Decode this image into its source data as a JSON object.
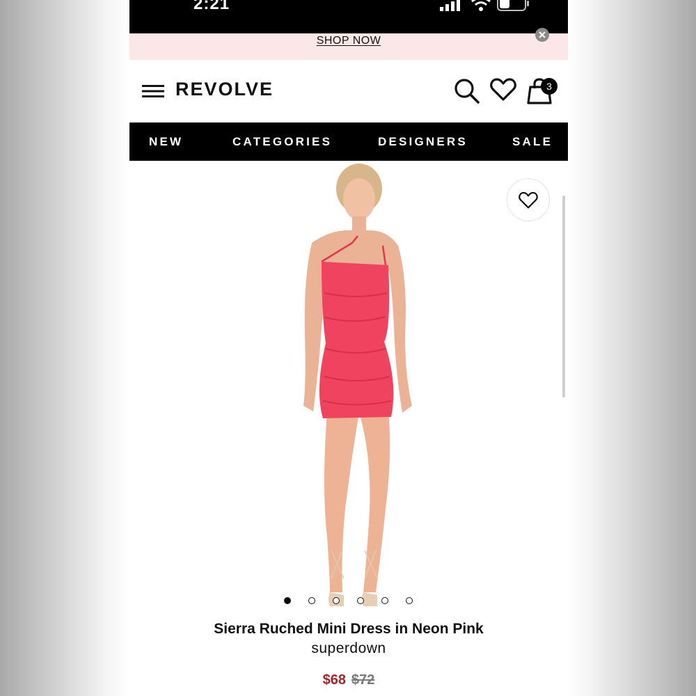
{
  "status_bar": {
    "time": "2:21"
  },
  "promo": {
    "link_label": "SHOP NOW"
  },
  "header": {
    "logo": "REVOLVE",
    "bag_count": "3"
  },
  "nav": {
    "items": [
      {
        "label": "NEW"
      },
      {
        "label": "CATEGORIES"
      },
      {
        "label": "DESIGNERS"
      },
      {
        "label": "SALE"
      }
    ]
  },
  "product": {
    "title": "Sierra Ruched Mini Dress in Neon Pink",
    "brand": "superdown",
    "price_sale": "$68",
    "price_original": "$72",
    "gallery_count": 6,
    "gallery_active": 1,
    "dress_color": "#f0435f"
  },
  "icons": [
    "menu-icon",
    "search-icon",
    "heart-icon",
    "shopping-bag-icon",
    "close-icon",
    "signal-icon",
    "wifi-icon",
    "battery-icon"
  ]
}
